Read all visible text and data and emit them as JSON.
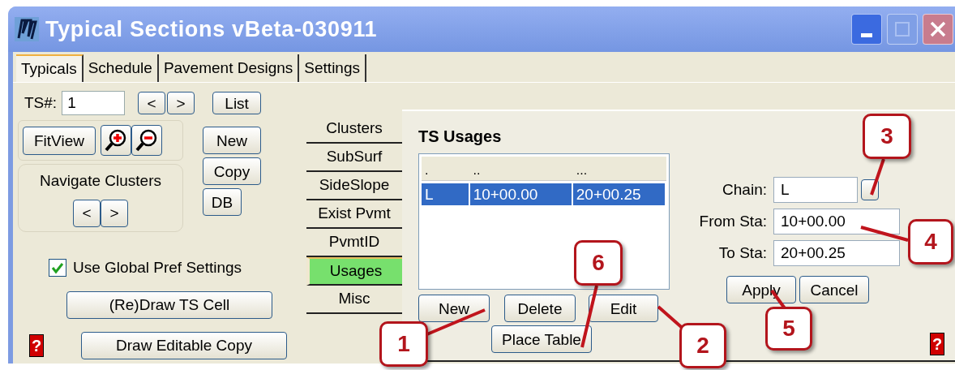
{
  "window": {
    "title": "Typical Sections vBeta-030911"
  },
  "tabs": [
    {
      "label": "Typicals",
      "selected": true
    },
    {
      "label": "Schedule",
      "selected": false
    },
    {
      "label": "Pavement Designs",
      "selected": false
    },
    {
      "label": "Settings",
      "selected": false
    }
  ],
  "ts_number": {
    "label": "TS#:",
    "value": "1",
    "prev": "<",
    "next": ">",
    "list": "List"
  },
  "view": {
    "fit_view": "FitView"
  },
  "cluster_buttons": [
    "New",
    "Copy",
    "DB"
  ],
  "navigate_clusters": {
    "label": "Navigate Clusters",
    "prev": "<",
    "next": ">"
  },
  "use_global_pref": {
    "label": "Use Global Pref Settings",
    "checked": true
  },
  "action_buttons": [
    "(Re)Draw TS Cell",
    "Draw Editable Copy"
  ],
  "help_left": "?",
  "side_tabs": [
    {
      "label": "Clusters",
      "selected": false
    },
    {
      "label": "SubSurf",
      "selected": false
    },
    {
      "label": "SideSlope",
      "selected": false
    },
    {
      "label": "Exist Pvmt",
      "selected": false
    },
    {
      "label": "PvmtID",
      "selected": false
    },
    {
      "label": "Usages",
      "selected": true
    },
    {
      "label": "Misc",
      "selected": false
    }
  ],
  "usages": {
    "title": "TS Usages",
    "columns": [
      ".",
      "..",
      "..."
    ],
    "rows": [
      {
        "cells": [
          "L",
          "10+00.00",
          "20+00.25"
        ],
        "selected": true
      }
    ],
    "buttons": [
      "New",
      "Delete",
      "Edit"
    ],
    "place_table": "Place Table"
  },
  "form": {
    "fields": [
      {
        "label": "Chain:",
        "value": "L",
        "kind": "picker"
      },
      {
        "label": "From Sta:",
        "value": "10+00.00",
        "kind": "text"
      },
      {
        "label": "To Sta:",
        "value": "20+00.25",
        "kind": "text"
      }
    ],
    "buttons": [
      "Apply",
      "Cancel"
    ]
  },
  "help_right": "?",
  "callouts": [
    "1",
    "2",
    "3",
    "4",
    "5",
    "6"
  ]
}
